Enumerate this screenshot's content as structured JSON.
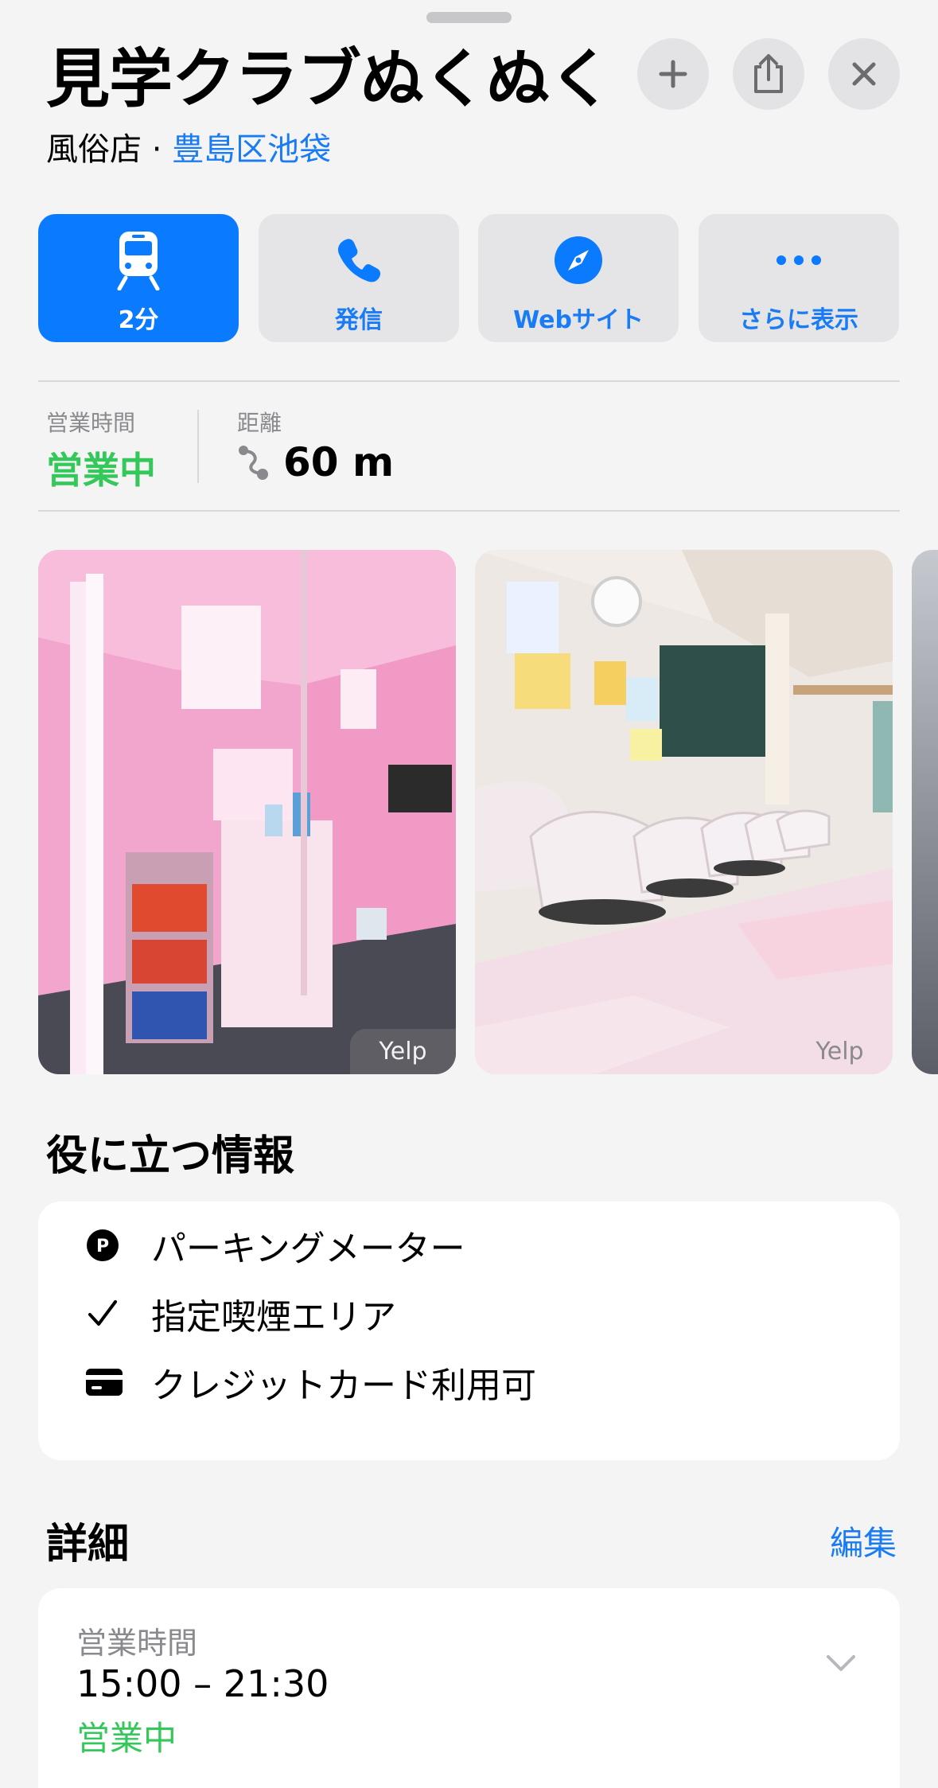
{
  "header": {
    "title": "見学クラブぬくぬく",
    "category": "風俗店",
    "separator": " · ",
    "location": "豊島区池袋"
  },
  "top_buttons": {
    "add": "add-icon",
    "share": "share-icon",
    "close": "close-icon"
  },
  "actions": [
    {
      "label": "2分",
      "icon": "train-icon"
    },
    {
      "label": "発信",
      "icon": "phone-icon"
    },
    {
      "label": "Webサイト",
      "icon": "compass-icon"
    },
    {
      "label": "さらに表示",
      "icon": "more-icon"
    }
  ],
  "info": {
    "hours_label": "営業時間",
    "hours_status": "営業中",
    "distance_label": "距離",
    "distance_value": "60 m"
  },
  "photos": [
    {
      "source": "Yelp"
    },
    {
      "source": "Yelp"
    }
  ],
  "useful": {
    "title": "役に立つ情報",
    "items": [
      {
        "icon": "parking-icon",
        "text": "パーキングメーター"
      },
      {
        "icon": "check-icon",
        "text": "指定喫煙エリア"
      },
      {
        "icon": "credit-card-icon",
        "text": "クレジットカード利用可"
      }
    ]
  },
  "details": {
    "title": "詳細",
    "edit": "編集",
    "hours_label": "営業時間",
    "hours": "15:00 – 21:30",
    "status": "営業中"
  },
  "colors": {
    "accent": "#0a7aff",
    "link": "#1a7cf5",
    "open": "#34c759"
  }
}
